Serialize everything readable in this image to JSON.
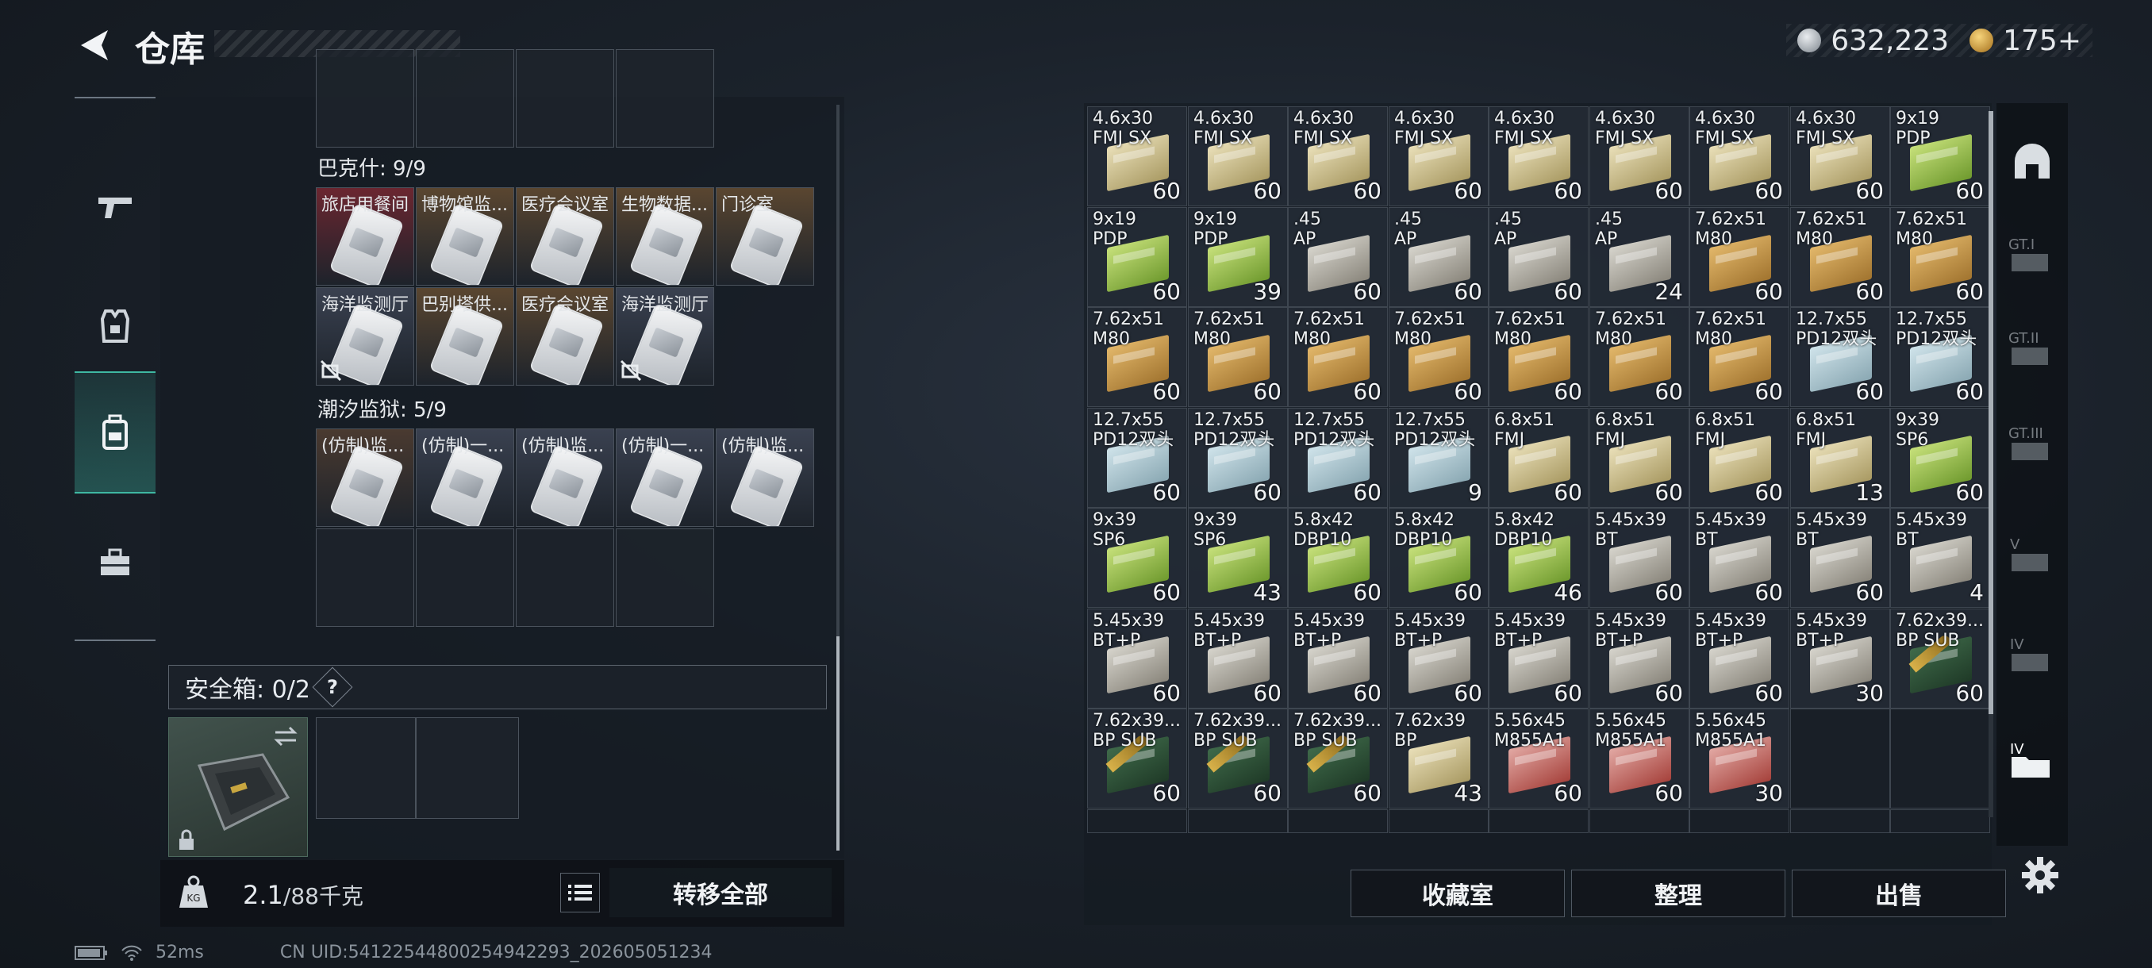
{
  "header": {
    "title": "仓库",
    "currency1": "632,223",
    "currency2": "175+"
  },
  "left": {
    "section1": "巴克什: 9/9",
    "section1_items": [
      {
        "label": "旅店用餐间",
        "color": "#6b2630",
        "locked": false
      },
      {
        "label": "博物馆监...",
        "color": "#5a4630",
        "locked": false
      },
      {
        "label": "医疗会议室",
        "color": "#5a4630",
        "locked": false
      },
      {
        "label": "生物数据...",
        "color": "#5a4630",
        "locked": false
      },
      {
        "label": "门诊室",
        "color": "#5a4630",
        "locked": false
      },
      {
        "label": "海洋监测厅",
        "color": "#3a4150",
        "locked": true
      },
      {
        "label": "巴别塔供...",
        "color": "#5a4630",
        "locked": false
      },
      {
        "label": "医疗会议室",
        "color": "#5a4630",
        "locked": false
      },
      {
        "label": "海洋监测厅",
        "color": "#3a4150",
        "locked": true
      }
    ],
    "section2": "潮汐监狱: 5/9",
    "section2_items": [
      {
        "label": "(仿制)监...",
        "color": "#4a3a30"
      },
      {
        "label": "(仿制)一...",
        "color": "#3a4150"
      },
      {
        "label": "(仿制)监...",
        "color": "#3a4150"
      },
      {
        "label": "(仿制)一...",
        "color": "#3a4150"
      },
      {
        "label": "(仿制)监...",
        "color": "#3a4150"
      }
    ],
    "safe_box": "安全箱: 0/2",
    "help": "?",
    "weight_value": "2.1",
    "weight_cap": "/88千克",
    "transfer_all": "转移全部"
  },
  "inventory": [
    {
      "n": "4.6x30\nFMJ SX",
      "q": "60",
      "t": "tan"
    },
    {
      "n": "4.6x30\nFMJ SX",
      "q": "60",
      "t": "tan"
    },
    {
      "n": "4.6x30\nFMJ SX",
      "q": "60",
      "t": "tan"
    },
    {
      "n": "4.6x30\nFMJ SX",
      "q": "60",
      "t": "tan"
    },
    {
      "n": "4.6x30\nFMJ SX",
      "q": "60",
      "t": "tan"
    },
    {
      "n": "4.6x30\nFMJ SX",
      "q": "60",
      "t": "tan"
    },
    {
      "n": "4.6x30\nFMJ SX",
      "q": "60",
      "t": "tan"
    },
    {
      "n": "4.6x30\nFMJ SX",
      "q": "60",
      "t": "tan"
    },
    {
      "n": "9x19\nPDP",
      "q": "60",
      "t": "green"
    },
    {
      "n": "9x19\nPDP",
      "q": "60",
      "t": "green"
    },
    {
      "n": "9x19\nPDP",
      "q": "39",
      "t": "green"
    },
    {
      "n": ".45\nAP",
      "q": "60",
      "t": "grey"
    },
    {
      "n": ".45\nAP",
      "q": "60",
      "t": "grey"
    },
    {
      "n": ".45\nAP",
      "q": "60",
      "t": "grey"
    },
    {
      "n": ".45\nAP",
      "q": "24",
      "t": "grey"
    },
    {
      "n": "7.62x51\nM80",
      "q": "60",
      "t": "crate"
    },
    {
      "n": "7.62x51\nM80",
      "q": "60",
      "t": "crate"
    },
    {
      "n": "7.62x51\nM80",
      "q": "60",
      "t": "crate"
    },
    {
      "n": "7.62x51\nM80",
      "q": "60",
      "t": "crate"
    },
    {
      "n": "7.62x51\nM80",
      "q": "60",
      "t": "crate"
    },
    {
      "n": "7.62x51\nM80",
      "q": "60",
      "t": "crate"
    },
    {
      "n": "7.62x51\nM80",
      "q": "60",
      "t": "crate"
    },
    {
      "n": "7.62x51\nM80",
      "q": "60",
      "t": "crate"
    },
    {
      "n": "7.62x51\nM80",
      "q": "60",
      "t": "crate"
    },
    {
      "n": "7.62x51\nM80",
      "q": "60",
      "t": "crate"
    },
    {
      "n": "12.7x55\nPD12双头",
      "q": "60",
      "t": "blue"
    },
    {
      "n": "12.7x55\nPD12双头",
      "q": "60",
      "t": "blue"
    },
    {
      "n": "12.7x55\nPD12双头",
      "q": "60",
      "t": "blue"
    },
    {
      "n": "12.7x55\nPD12双头",
      "q": "60",
      "t": "blue"
    },
    {
      "n": "12.7x55\nPD12双头",
      "q": "60",
      "t": "blue"
    },
    {
      "n": "12.7x55\nPD12双头",
      "q": "9",
      "t": "blue"
    },
    {
      "n": "6.8x51\nFMJ",
      "q": "60",
      "t": "tan"
    },
    {
      "n": "6.8x51\nFMJ",
      "q": "60",
      "t": "tan"
    },
    {
      "n": "6.8x51\nFMJ",
      "q": "60",
      "t": "tan"
    },
    {
      "n": "6.8x51\nFMJ",
      "q": "13",
      "t": "tan"
    },
    {
      "n": "9x39\nSP6",
      "q": "60",
      "t": "green"
    },
    {
      "n": "9x39\nSP6",
      "q": "60",
      "t": "green"
    },
    {
      "n": "9x39\nSP6",
      "q": "43",
      "t": "green"
    },
    {
      "n": "5.8x42\nDBP10",
      "q": "60",
      "t": "green"
    },
    {
      "n": "5.8x42\nDBP10",
      "q": "60",
      "t": "green"
    },
    {
      "n": "5.8x42\nDBP10",
      "q": "46",
      "t": "green"
    },
    {
      "n": "5.45x39\nBT",
      "q": "60",
      "t": "grey"
    },
    {
      "n": "5.45x39\nBT",
      "q": "60",
      "t": "grey"
    },
    {
      "n": "5.45x39\nBT",
      "q": "60",
      "t": "grey"
    },
    {
      "n": "5.45x39\nBT",
      "q": "4",
      "t": "grey"
    },
    {
      "n": "5.45x39\nBT+P",
      "q": "60",
      "t": "grey"
    },
    {
      "n": "5.45x39\nBT+P",
      "q": "60",
      "t": "grey"
    },
    {
      "n": "5.45x39\nBT+P",
      "q": "60",
      "t": "grey"
    },
    {
      "n": "5.45x39\nBT+P",
      "q": "60",
      "t": "grey"
    },
    {
      "n": "5.45x39\nBT+P",
      "q": "60",
      "t": "grey"
    },
    {
      "n": "5.45x39\nBT+P",
      "q": "60",
      "t": "grey"
    },
    {
      "n": "5.45x39\nBT+P",
      "q": "60",
      "t": "grey"
    },
    {
      "n": "5.45x39\nBT+P",
      "q": "30",
      "t": "grey"
    },
    {
      "n": "7.62x39...\nBP SUB",
      "q": "60",
      "t": "bullet"
    },
    {
      "n": "7.62x39...\nBP SUB",
      "q": "60",
      "t": "bullet"
    },
    {
      "n": "7.62x39...\nBP SUB",
      "q": "60",
      "t": "bullet"
    },
    {
      "n": "7.62x39...\nBP SUB",
      "q": "60",
      "t": "bullet"
    },
    {
      "n": "7.62x39\nBP",
      "q": "43",
      "t": "tan"
    },
    {
      "n": "5.56x45\nM855A1",
      "q": "60",
      "t": "red"
    },
    {
      "n": "5.56x45\nM855A1",
      "q": "60",
      "t": "red"
    },
    {
      "n": "5.56x45\nM855A1",
      "q": "30",
      "t": "red"
    }
  ],
  "actions": {
    "collection": "收藏室",
    "sort": "整理",
    "sell": "出售"
  },
  "status": {
    "ping": "52ms",
    "uid": "CN UID:54122544800254942293_202605051234"
  }
}
